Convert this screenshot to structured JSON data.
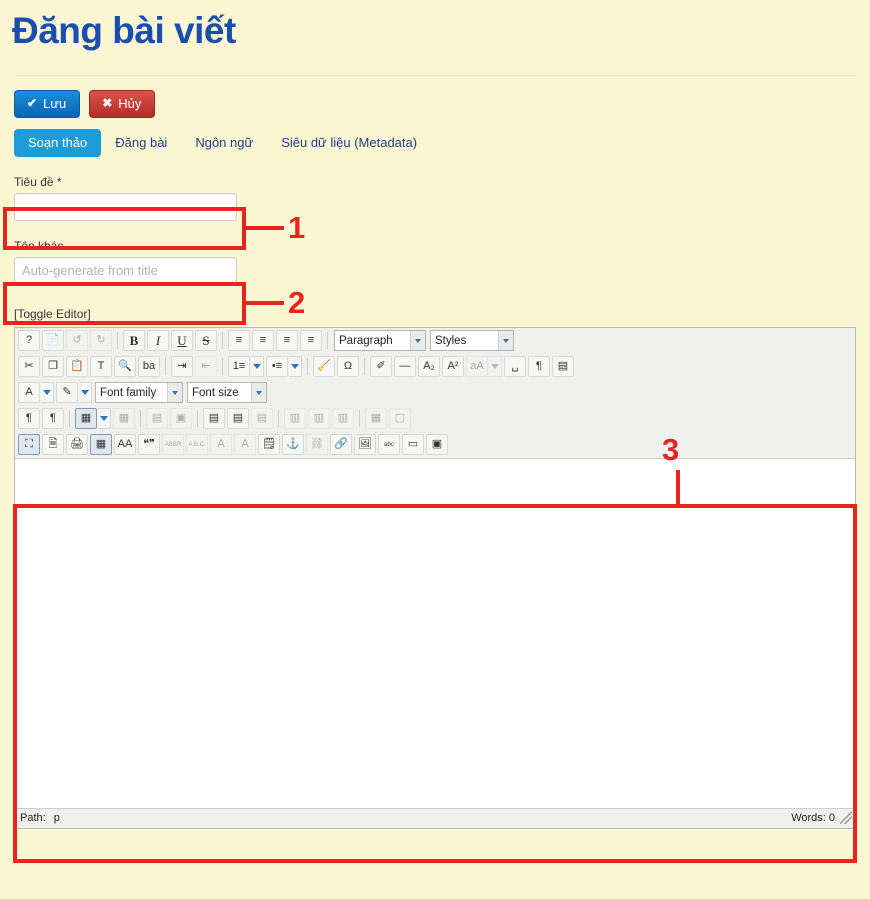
{
  "page": {
    "title": "Đăng bài viết"
  },
  "actions": {
    "save": {
      "label": "Lưu",
      "glyph": "✔",
      "color": "#0a63b5"
    },
    "cancel": {
      "label": "Hủy",
      "glyph": "✖",
      "color": "#b52b27"
    }
  },
  "tabs": [
    {
      "label": "Soạn thảo",
      "active": true
    },
    {
      "label": "Đăng bài",
      "active": false
    },
    {
      "label": "Ngôn ngữ",
      "active": false
    },
    {
      "label": "Siêu dữ liệu (Metadata)",
      "active": false
    }
  ],
  "fields": {
    "title": {
      "label": "Tiêu đề *",
      "value": "",
      "placeholder": ""
    },
    "alias": {
      "label": "Tên khác",
      "value": "",
      "placeholder": "Auto-generate from title"
    }
  },
  "toggle_editor": {
    "label": "[Toggle Editor]"
  },
  "editor": {
    "rows": [
      {
        "items": [
          {
            "type": "button",
            "name": "help-icon",
            "glyph": "?"
          },
          {
            "type": "button",
            "name": "new-document-icon",
            "glyph": "📄"
          },
          {
            "type": "button",
            "name": "undo-icon",
            "glyph": "↺",
            "disabled": true
          },
          {
            "type": "button",
            "name": "redo-icon",
            "glyph": "↻",
            "disabled": true
          },
          {
            "type": "sep"
          },
          {
            "type": "button",
            "name": "bold-icon",
            "glyph": "B"
          },
          {
            "type": "button",
            "name": "italic-icon",
            "glyph": "I"
          },
          {
            "type": "button",
            "name": "underline-icon",
            "glyph": "U"
          },
          {
            "type": "button",
            "name": "strikethrough-icon",
            "glyph": "S"
          },
          {
            "type": "sep"
          },
          {
            "type": "button",
            "name": "align-justify-icon",
            "glyph": "≡"
          },
          {
            "type": "button",
            "name": "align-center-icon",
            "glyph": "≡"
          },
          {
            "type": "button",
            "name": "align-left-icon",
            "glyph": "≡"
          },
          {
            "type": "button",
            "name": "align-right-icon",
            "glyph": "≡"
          },
          {
            "type": "sep"
          },
          {
            "type": "select",
            "name": "paragraph-format-select",
            "label": "Paragraph",
            "width": "sel-paragraph"
          },
          {
            "type": "select",
            "name": "styles-select",
            "label": "Styles",
            "width": "sel-styles"
          }
        ]
      },
      {
        "items": [
          {
            "type": "button",
            "name": "cut-icon",
            "glyph": "✂"
          },
          {
            "type": "button",
            "name": "copy-icon",
            "glyph": "❐"
          },
          {
            "type": "button",
            "name": "paste-icon",
            "glyph": "📋"
          },
          {
            "type": "button",
            "name": "paste-as-text-icon",
            "glyph": "T"
          },
          {
            "type": "button",
            "name": "find-replace-icon",
            "glyph": "🔍"
          },
          {
            "type": "button",
            "name": "spellcheck-ba-icon",
            "glyph": "ba"
          },
          {
            "type": "sep"
          },
          {
            "type": "button",
            "name": "indent-increase-icon",
            "glyph": "⇥"
          },
          {
            "type": "button",
            "name": "indent-decrease-icon",
            "glyph": "⇤",
            "disabled": true
          },
          {
            "type": "sep"
          },
          {
            "type": "button",
            "name": "numbered-list-icon",
            "glyph": "1≡"
          },
          {
            "type": "arrow",
            "name": "numbered-list-options-arrow"
          },
          {
            "type": "button",
            "name": "bullet-list-icon",
            "glyph": "•≡"
          },
          {
            "type": "arrow",
            "name": "bullet-list-options-arrow"
          },
          {
            "type": "sep"
          },
          {
            "type": "button",
            "name": "clean-formatting-icon",
            "glyph": "🧹"
          },
          {
            "type": "button",
            "name": "special-character-icon",
            "glyph": "Ω"
          },
          {
            "type": "sep"
          },
          {
            "type": "button",
            "name": "remove-format-icon",
            "glyph": "✐"
          },
          {
            "type": "button",
            "name": "horizontal-rule-icon",
            "glyph": "—"
          },
          {
            "type": "button",
            "name": "subscript-icon",
            "glyph": "A₂"
          },
          {
            "type": "button",
            "name": "superscript-icon",
            "glyph": "A²"
          },
          {
            "type": "button",
            "name": "anchor-a-icon",
            "glyph": "aA",
            "disabled": true
          },
          {
            "type": "arrow",
            "name": "anchor-options-arrow",
            "disabled": true
          },
          {
            "type": "button",
            "name": "insert-nonbreaking-icon",
            "glyph": "␣"
          },
          {
            "type": "button",
            "name": "show-invisible-icon",
            "glyph": "¶"
          },
          {
            "type": "button",
            "name": "page-break-icon",
            "glyph": "▤"
          }
        ]
      },
      {
        "items": [
          {
            "type": "button",
            "name": "text-color-icon",
            "glyph": "A"
          },
          {
            "type": "arrow",
            "name": "text-color-arrow"
          },
          {
            "type": "button",
            "name": "background-color-icon",
            "glyph": "✎"
          },
          {
            "type": "arrow",
            "name": "background-color-arrow"
          },
          {
            "type": "select",
            "name": "font-family-select",
            "label": "Font family",
            "width": "sel-fontfamily"
          },
          {
            "type": "select",
            "name": "font-size-select",
            "label": "Font size",
            "width": "sel-fontsize"
          }
        ]
      },
      {
        "items": [
          {
            "type": "button",
            "name": "ltr-direction-icon",
            "glyph": "¶"
          },
          {
            "type": "button",
            "name": "rtl-direction-icon",
            "glyph": "¶"
          },
          {
            "type": "sep"
          },
          {
            "type": "button",
            "name": "insert-table-icon",
            "glyph": "▦",
            "pressed": true
          },
          {
            "type": "arrow",
            "name": "table-options-arrow"
          },
          {
            "type": "button",
            "name": "delete-table-icon",
            "glyph": "▦",
            "disabled": true
          },
          {
            "type": "sep"
          },
          {
            "type": "button",
            "name": "table-row-properties-icon",
            "glyph": "▤",
            "disabled": true
          },
          {
            "type": "button",
            "name": "table-cell-properties-icon",
            "glyph": "▣",
            "disabled": true
          },
          {
            "type": "sep"
          },
          {
            "type": "button",
            "name": "insert-row-before-icon",
            "glyph": "▤"
          },
          {
            "type": "button",
            "name": "insert-row-after-icon",
            "glyph": "▤"
          },
          {
            "type": "button",
            "name": "delete-row-icon",
            "glyph": "▤",
            "disabled": true
          },
          {
            "type": "sep"
          },
          {
            "type": "button",
            "name": "insert-column-before-icon",
            "glyph": "▥",
            "disabled": true
          },
          {
            "type": "button",
            "name": "insert-column-after-icon",
            "glyph": "▥",
            "disabled": true
          },
          {
            "type": "button",
            "name": "delete-column-icon",
            "glyph": "▥",
            "disabled": true
          },
          {
            "type": "sep"
          },
          {
            "type": "button",
            "name": "split-cells-icon",
            "glyph": "▦",
            "disabled": true
          },
          {
            "type": "button",
            "name": "merge-cells-icon",
            "glyph": "▢",
            "disabled": true
          }
        ]
      },
      {
        "items": [
          {
            "type": "button",
            "name": "fullscreen-icon",
            "glyph": "⛶",
            "pressed": true
          },
          {
            "type": "button",
            "name": "preview-icon",
            "glyph": "🗎"
          },
          {
            "type": "button",
            "name": "print-icon",
            "glyph": "🖨"
          },
          {
            "type": "button",
            "name": "visual-aid-icon",
            "glyph": "▦",
            "pressed": true
          },
          {
            "type": "button",
            "name": "spellchecker-aa-icon",
            "glyph": "AA"
          },
          {
            "type": "button",
            "name": "blockquote-icon",
            "glyph": "❝❞"
          },
          {
            "type": "button",
            "name": "abbreviation-icon",
            "glyph": "ABBR",
            "disabled": true
          },
          {
            "type": "button",
            "name": "acronym-icon",
            "glyph": "A.B.C.",
            "disabled": true
          },
          {
            "type": "button",
            "name": "delete-text-icon",
            "glyph": "A",
            "disabled": true
          },
          {
            "type": "button",
            "name": "insert-text-icon",
            "glyph": "A",
            "disabled": true
          },
          {
            "type": "button",
            "name": "edit-attributes-icon",
            "glyph": "🗒"
          },
          {
            "type": "button",
            "name": "insert-anchor-icon",
            "glyph": "⚓"
          },
          {
            "type": "button",
            "name": "unlink-icon",
            "glyph": "⛓",
            "disabled": true
          },
          {
            "type": "button",
            "name": "insert-link-icon",
            "glyph": "🔗"
          },
          {
            "type": "button",
            "name": "insert-image-icon",
            "glyph": "🖼"
          },
          {
            "type": "button",
            "name": "spellchecker-abc-icon",
            "glyph": "abc"
          },
          {
            "type": "button",
            "name": "insert-readmore-icon",
            "glyph": "▭"
          },
          {
            "type": "button",
            "name": "insert-module-icon",
            "glyph": "▣"
          }
        ]
      }
    ],
    "content": "",
    "status": {
      "path_label": "Path:",
      "path_value": "p",
      "words_label": "Words: 0"
    }
  },
  "annotations": [
    {
      "number": "1",
      "target": "title-field"
    },
    {
      "number": "2",
      "target": "alias-field"
    },
    {
      "number": "3",
      "target": "editor-body"
    }
  ],
  "colors": {
    "page_background": "#fdf6d3",
    "title_blue": "#1a4fad",
    "accent_blue": "#1b9bd8",
    "annotation_red": "#e8241f"
  }
}
